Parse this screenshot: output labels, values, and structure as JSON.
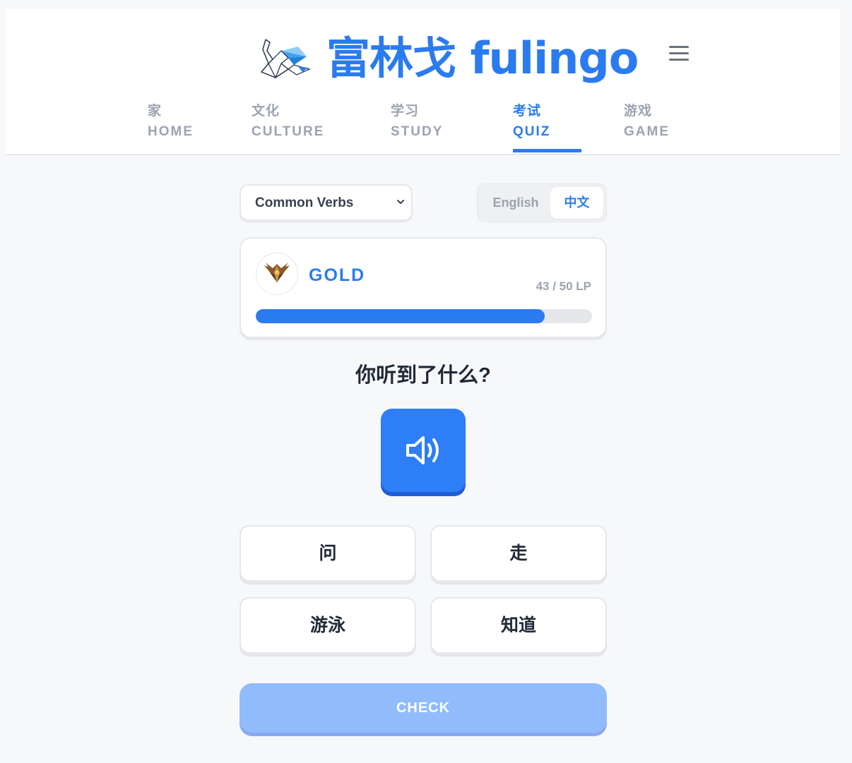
{
  "header": {
    "logo_text": "富林戈 fulingo",
    "logo_icon": "origami-swan-icon",
    "menu_icon": "hamburger-menu-icon"
  },
  "nav": {
    "items": [
      {
        "zh": "家",
        "en": "HOME"
      },
      {
        "zh": "文化",
        "en": "CULTURE"
      },
      {
        "zh": "学习",
        "en": "STUDY"
      },
      {
        "zh": "考试",
        "en": "QUIZ"
      },
      {
        "zh": "游戏",
        "en": "GAME"
      }
    ],
    "active": "QUIZ"
  },
  "controls": {
    "topic_selected": "Common Verbs",
    "lang_options": [
      "English",
      "中文"
    ],
    "lang_active": "中文"
  },
  "rank": {
    "name": "GOLD",
    "badge_icon": "gold-wings-badge-icon",
    "lp_text": "43 / 50 LP",
    "lp_current": 43,
    "lp_max": 50
  },
  "quiz": {
    "question": "你听到了什么?",
    "audio_icon": "speaker-icon",
    "options": [
      "问",
      "走",
      "游泳",
      "知道"
    ],
    "check_label": "CHECK"
  },
  "colors": {
    "accent": "#2b7bf0",
    "check_disabled": "#90bcfb",
    "muted": "#9ca3af"
  }
}
